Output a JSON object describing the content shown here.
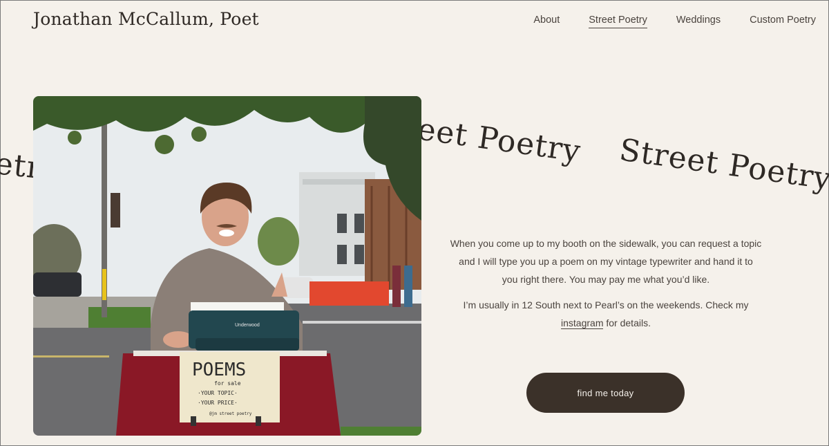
{
  "header": {
    "site_title": "Jonathan McCallum, Poet",
    "nav": [
      {
        "label": "About"
      },
      {
        "label": "Street Poetry",
        "active": true
      },
      {
        "label": "Weddings"
      },
      {
        "label": "Custom Poetry"
      }
    ]
  },
  "marquee": {
    "text_left": "etr",
    "text_middle": "eet Poetry",
    "text_right": "Street Poetry"
  },
  "photo": {
    "sign_title": "POEMS",
    "sign_line1": "for sale",
    "sign_line2": "·YOUR TOPIC·",
    "sign_line3": "·YOUR PRICE·",
    "sign_handle": "@jm street poetry",
    "typewriter_brand": "Underwood"
  },
  "content": {
    "paragraph1": "When you come up to my booth on the sidewalk, you can request a topic and I will type you up a poem on my vintage typewriter and hand it to you right there. You may pay me what you’d like.",
    "paragraph2_before": "I’m usually in 12 South next to Pearl’s on the weekends. Check my ",
    "paragraph2_link": "instagram",
    "paragraph2_after": " for details."
  },
  "cta": {
    "label": "find me today"
  },
  "colors": {
    "background": "#f5f1eb",
    "button": "#3b3129",
    "text": "#4a433e"
  }
}
